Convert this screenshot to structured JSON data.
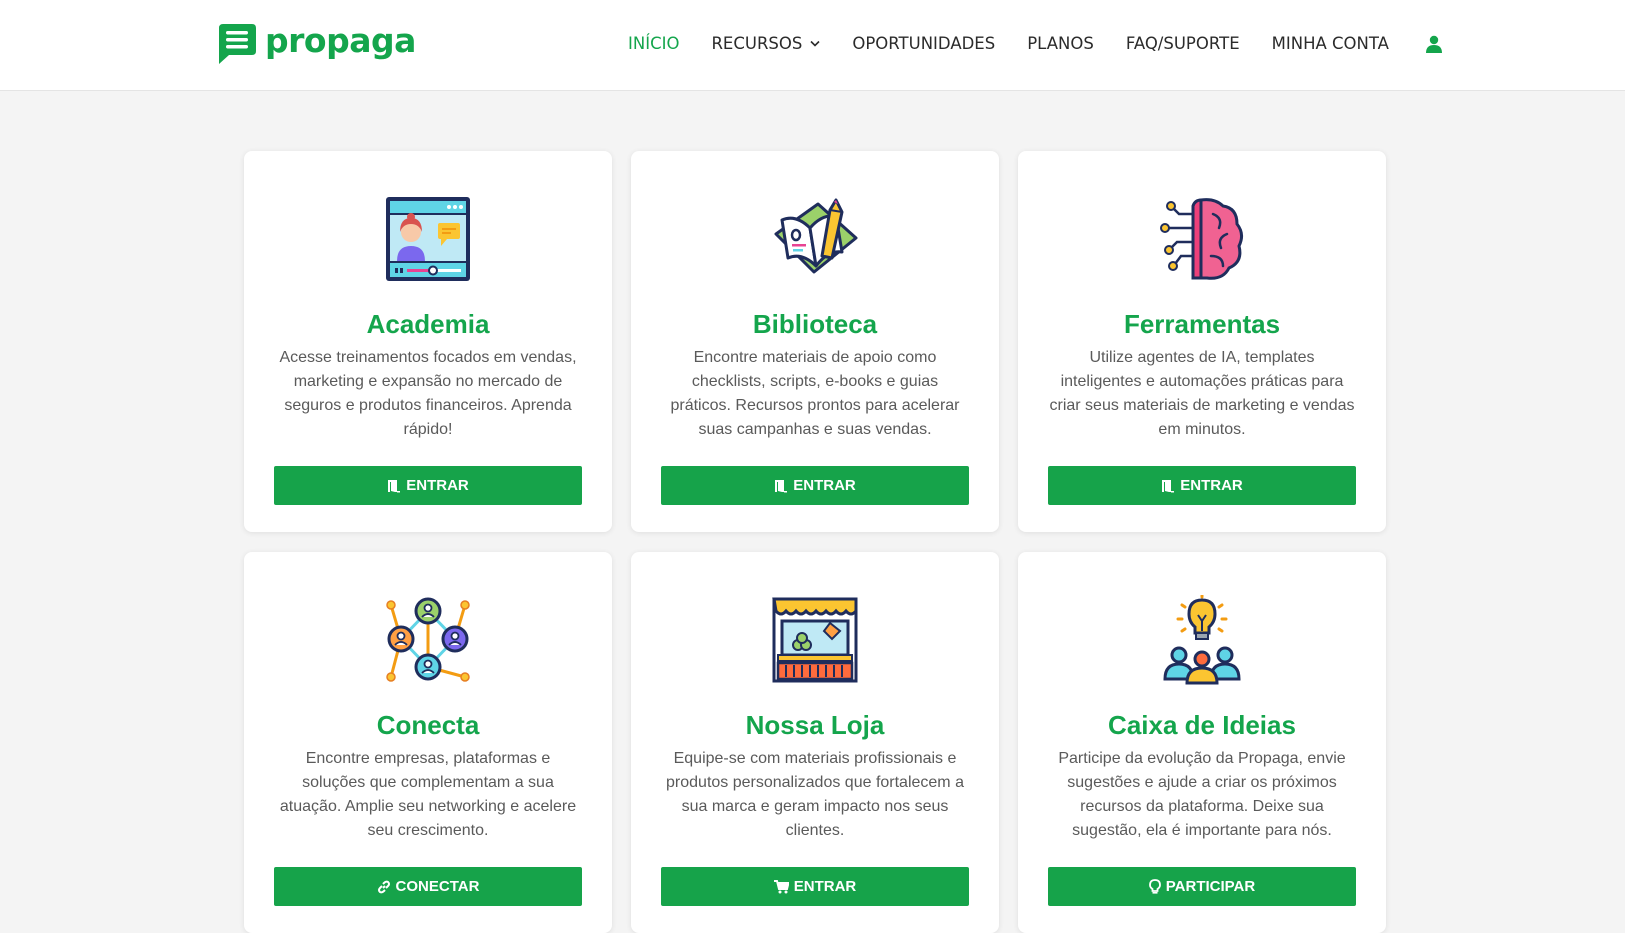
{
  "brand": {
    "name": "propaga",
    "color": "#14a54c"
  },
  "nav": {
    "items": [
      {
        "label": "INÍCIO",
        "active": true
      },
      {
        "label": "RECURSOS",
        "dropdown": true
      },
      {
        "label": "OPORTUNIDADES"
      },
      {
        "label": "PLANOS"
      },
      {
        "label": "FAQ/SUPORTE"
      },
      {
        "label": "MINHA CONTA"
      }
    ],
    "user_icon": "user-icon"
  },
  "cards": [
    {
      "title": "Academia",
      "description": "Acesse treinamentos focados em vendas, marketing e expansão no mercado de seguros e produtos financeiros. Aprenda rápido!",
      "button": "ENTRAR",
      "button_icon": "door-enter-icon",
      "icon": "video-lesson-icon"
    },
    {
      "title": "Biblioteca",
      "description": "Encontre materiais de apoio como checklists, scripts, e-books e guias práticos. Recursos prontos para acelerar suas campanhas e suas vendas.",
      "button": "ENTRAR",
      "button_icon": "door-enter-icon",
      "icon": "book-pencil-icon"
    },
    {
      "title": "Ferramentas",
      "description": "Utilize agentes de IA, templates inteligentes e automações práticas para criar seus materiais de marketing e vendas em minutos.",
      "button": "ENTRAR",
      "button_icon": "door-enter-icon",
      "icon": "ai-brain-icon"
    },
    {
      "title": "Conecta",
      "description": "Encontre empresas, plataformas e soluções que complementam a sua atuação. Amplie seu networking e acelere seu crescimento.",
      "button": "CONECTAR",
      "button_icon": "link-icon",
      "icon": "network-people-icon"
    },
    {
      "title": "Nossa Loja",
      "description": "Equipe-se com materiais profissionais e produtos personalizados que fortalecem a sua marca e geram impacto nos seus clientes.",
      "button": "ENTRAR",
      "button_icon": "cart-icon",
      "icon": "storefront-icon"
    },
    {
      "title": "Caixa de Ideias",
      "description": "Participe da evolução da Propaga, envie sugestões e ajude a criar os próximos recursos da plataforma. Deixe sua sugestão, ela é importante para nós.",
      "button": "PARTICIPAR",
      "button_icon": "lightbulb-icon",
      "icon": "team-idea-icon"
    }
  ]
}
